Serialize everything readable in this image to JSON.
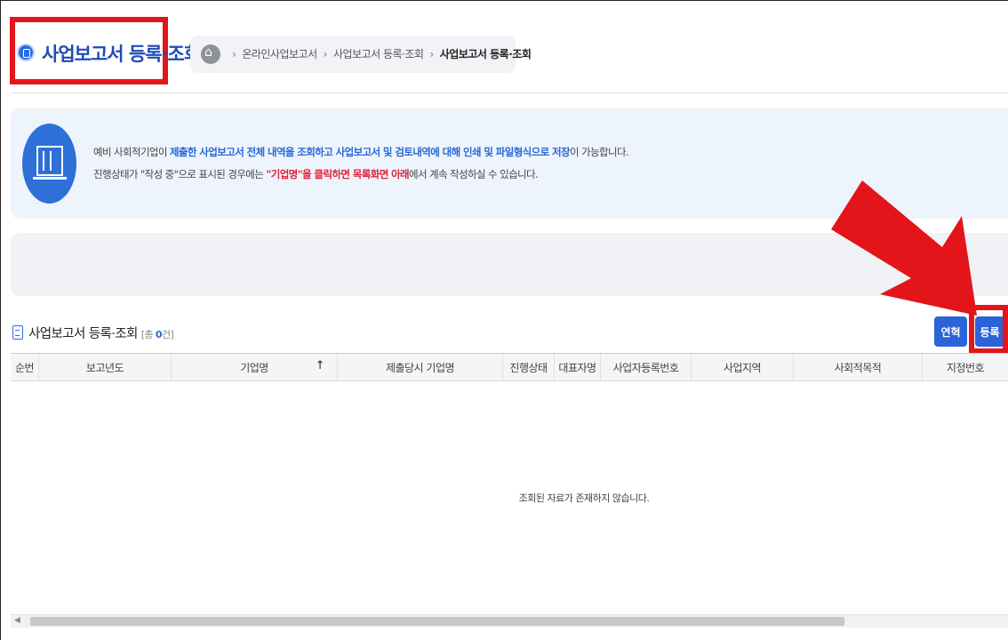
{
  "page": {
    "title": "사업보고서 등록·조회"
  },
  "breadcrumb": {
    "items": [
      "온라인사업보고서",
      "사업보고서 등록·조회",
      "사업보고서 등록·조회"
    ]
  },
  "info": {
    "line1": {
      "a": "예비 사회적기업이 ",
      "b": "제출한 사업보고서 전체 내역을 조회하고 사업보고서 및 검토내역에 대해 인쇄 및 파일형식으로 저장",
      "c": "이 가능합니다."
    },
    "line2": {
      "a": "진행상태가 \"작성 중\"으로 표시된 경우에는 ",
      "b": "\"기업명\"을 클릭하면 목록화면 아래",
      "c": "에서 계속 작성하실 수 있습니다."
    }
  },
  "list": {
    "title": "사업보고서 등록·조회",
    "count_prefix": "[총 ",
    "count_value": "0",
    "count_suffix": "건]",
    "buttons": {
      "history": "연혁",
      "register": "등록"
    },
    "columns": [
      "순번",
      "보고년도",
      "기업명",
      "제출당시 기업명",
      "진행상태",
      "대표자명",
      "사업자등록번호",
      "사업지역",
      "사회적목적",
      "지정번호"
    ],
    "sort_icon": "↑",
    "empty_message": "조회된 자료가 존재하지 않습니다."
  },
  "colors": {
    "accent_blue": "#2d63d9",
    "highlight_red": "#e4141b"
  },
  "icons": [
    "report-icon",
    "home-icon",
    "building-icon",
    "list-icon",
    "sort-arrow-icon",
    "scroll-left-icon"
  ]
}
